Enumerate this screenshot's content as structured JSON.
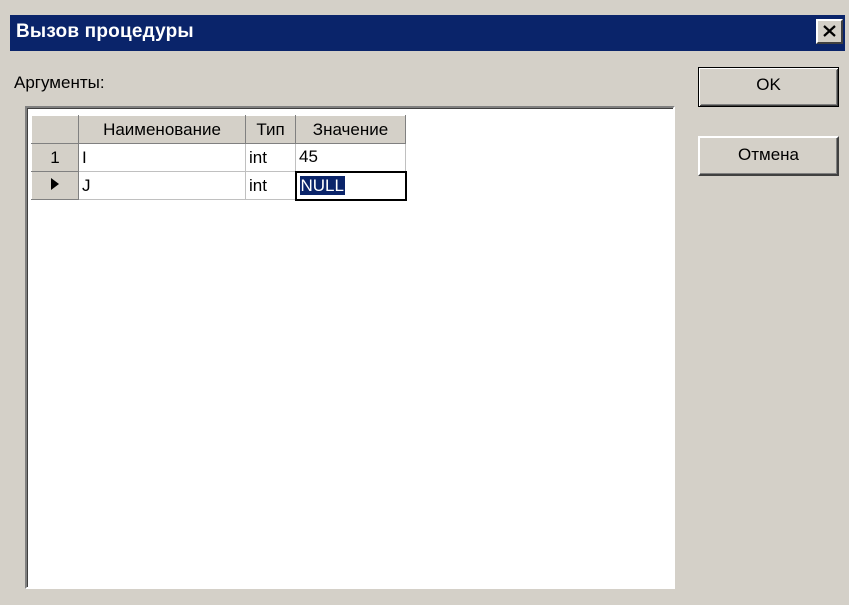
{
  "window": {
    "title": "Вызов процедуры",
    "close_icon": "close-icon"
  },
  "args": {
    "label": "Аргументы:"
  },
  "grid": {
    "columns": [
      "Наименование",
      "Тип",
      "Значение"
    ],
    "rows": [
      {
        "indicator": "1",
        "name": "I",
        "type": "int",
        "value": "45"
      },
      {
        "indicator": "▶",
        "name": "J",
        "type": "int",
        "value": "NULL"
      }
    ],
    "active_row_icon": "triangle-right-icon"
  },
  "buttons": {
    "ok": "OK",
    "cancel": "Отмена"
  },
  "colors": {
    "titlebar": "#0a246a",
    "face": "#d4d0c8",
    "selection": "#0a246a"
  }
}
